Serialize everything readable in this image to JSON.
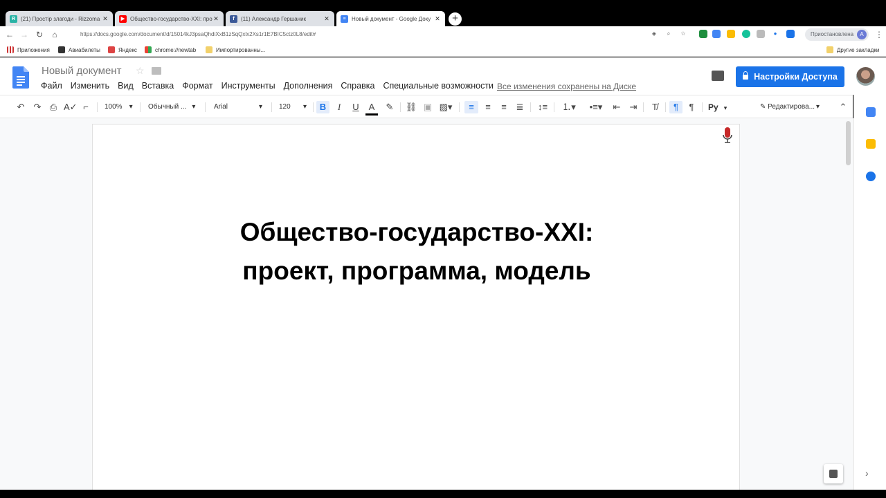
{
  "browser": {
    "tabs": [
      {
        "title": "(21) Простір злагоди - Rizzoma",
        "icon": "rizzoma-icon",
        "color": "#2ab3a6",
        "active": false
      },
      {
        "title": "Общество-государство-XXI: про",
        "icon": "youtube-icon",
        "color": "#ff0000",
        "active": false
      },
      {
        "title": "(11) Александр Гершаник",
        "icon": "facebook-icon",
        "color": "#3b5998",
        "active": false
      },
      {
        "title": "Новый документ - Google Доку",
        "icon": "google-docs-icon",
        "color": "#4285f4",
        "active": true
      }
    ],
    "url": "https://docs.google.com/document/d/15014kJ3psaQhdiXxB1zSqQxlx2Xs1r1E7BIC5ctz0L8/edit#",
    "profile_status": "Приостановлена",
    "profile_initial": "A"
  },
  "bookmarks": {
    "apps": "Приложения",
    "items": [
      "Авиабилеты",
      "Яндекс",
      "chrome://newtab",
      "Импортированны..."
    ],
    "other": "Другие закладки"
  },
  "docs": {
    "title": "Новый документ",
    "menu": [
      "Файл",
      "Изменить",
      "Вид",
      "Вставка",
      "Формат",
      "Инструменты",
      "Дополнения",
      "Справка",
      "Специальные возможности"
    ],
    "saved_status": "Все изменения сохранены на Диске",
    "share_label": "Настройки Доступа",
    "share_color": "#1a73e8"
  },
  "toolbar": {
    "zoom": "100%",
    "style": "Обычный ...",
    "font": "Arial",
    "size": "120",
    "language": "Ру",
    "mode": "Редактирова..."
  },
  "document": {
    "heading_line1": "Общество-государство-XXI:",
    "heading_line2": "проект, программа, модель"
  }
}
